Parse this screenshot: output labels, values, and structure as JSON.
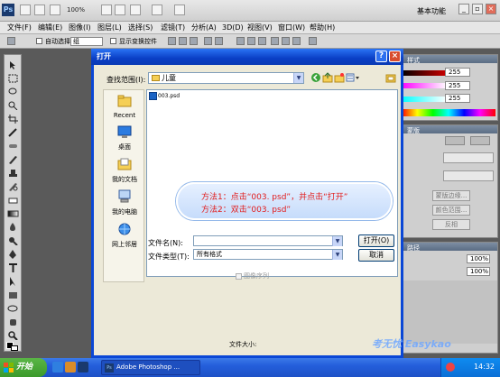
{
  "appbar": {
    "logo": "Ps",
    "zoom": "100%",
    "workspace": "基本功能"
  },
  "menu": [
    "文件(F)",
    "编辑(E)",
    "图像(I)",
    "图层(L)",
    "选择(S)",
    "滤镜(T)",
    "分析(A)",
    "3D(D)",
    "视图(V)",
    "窗口(W)",
    "帮助(H)"
  ],
  "options": {
    "auto_select_label": "自动选择:",
    "auto_select_value": "组",
    "show_transform_label": "显示变换控件"
  },
  "right_panels": {
    "color_tab": "样式",
    "numbers": [
      "255",
      "255",
      "255"
    ],
    "adjust_tab": "蒙版",
    "mask_buttons": [
      "蒙版边缘...",
      "颜色范围...",
      "反相"
    ],
    "layers_tab": "路径",
    "opacity": "100%",
    "fill": "100%"
  },
  "dialog": {
    "title": "打开",
    "help": "?",
    "close": "×",
    "lookin_label": "查找范围(I):",
    "lookin_value": "儿童",
    "places": [
      "Recent",
      "桌面",
      "我的文档",
      "我的电脑",
      "网上邻居"
    ],
    "files": [
      "003.psd"
    ],
    "filename_label": "文件名(N):",
    "filename_value": "",
    "filetype_label": "文件类型(T):",
    "filetype_value": "所有格式",
    "open_button": "打开(O)",
    "cancel_button": "取消",
    "sequence_label": "图像序列",
    "filesize_label": "文件大小:"
  },
  "callout": {
    "line1": "方法1：点击“003. psd”，并点击“打开”",
    "line2": "方法2：双击“003. psd”"
  },
  "taskbar": {
    "start": "开始",
    "task_label": "Adobe Photoshop ...",
    "clock": "14:32"
  },
  "watermark": "考无忧 Easykao",
  "colors": {
    "xp_title": "#0a47d6",
    "callout_text": "#e21b1b",
    "taskbar": "#245edb"
  }
}
